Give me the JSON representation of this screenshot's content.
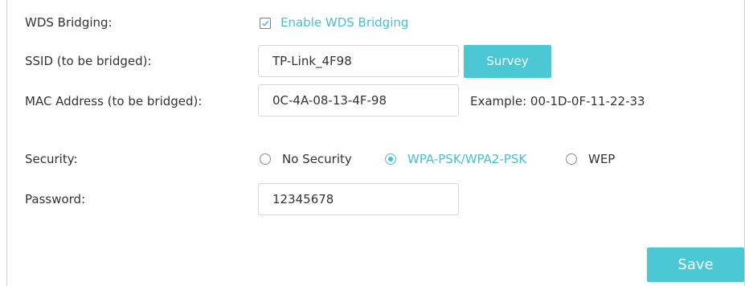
{
  "wds": {
    "label": "WDS Bridging:",
    "checkbox_label": "Enable WDS Bridging",
    "enabled": true
  },
  "ssid": {
    "label": "SSID (to be bridged):",
    "value": "TP-Link_4F98",
    "survey_button": "Survey"
  },
  "mac": {
    "label": "MAC Address (to be bridged):",
    "value": "0C-4A-08-13-4F-98",
    "example": "Example: 00-1D-0F-11-22-33"
  },
  "security": {
    "label": "Security:",
    "options": [
      {
        "label": "No Security",
        "selected": false
      },
      {
        "label": "WPA-PSK/WPA2-PSK",
        "selected": true
      },
      {
        "label": "WEP",
        "selected": false
      }
    ]
  },
  "password": {
    "label": "Password:",
    "value": "12345678"
  },
  "save_button": "Save",
  "colors": {
    "accent": "#4ac8d4",
    "accent_text": "#45c0cf",
    "text": "#333333",
    "border": "#d6d6d6"
  }
}
